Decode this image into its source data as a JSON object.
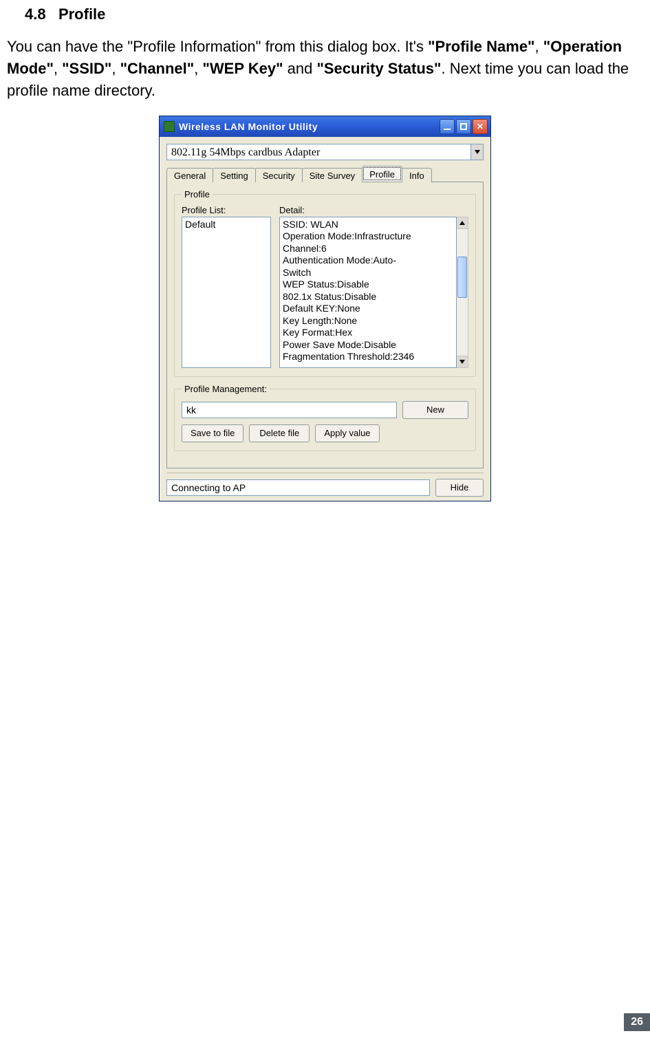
{
  "heading": {
    "number": "4.8",
    "title": "Profile"
  },
  "paragraph": {
    "p1a": "You can have the \"Profile Information\" from this dialog box. It's ",
    "b1": "\"Profile Name\"",
    "c1": ", ",
    "b2": "\"Operation Mode\"",
    "c2": ", ",
    "b3": "\"SSID\"",
    "c3": ", ",
    "b4": "\"Channel\"",
    "c4": ", ",
    "b5": "\"WEP Key\"",
    "c5": " and ",
    "b6": "\"Security Status\"",
    "p1b": ". Next time you can load the profile name directory."
  },
  "window": {
    "title": "Wireless LAN Monitor Utility",
    "adapter": "802.11g 54Mbps cardbus Adapter",
    "tabs": {
      "general": "General",
      "setting": "Setting",
      "security": "Security",
      "site_survey": "Site Survey",
      "profile": "Profile",
      "info": "Info"
    },
    "profile_group_legend": "Profile",
    "labels": {
      "profile_list": "Profile List:",
      "detail": "Detail:"
    },
    "profile_list": {
      "item0": "Default"
    },
    "detail_lines": {
      "l0": "SSID: WLAN",
      "l1": "Operation Mode:Infrastructure",
      "l2": "Channel:6",
      "l3": "Authentication Mode:Auto-",
      "l4": "Switch",
      "l5": "WEP Status:Disable",
      "l6": "802.1x Status:Disable",
      "l7": "Default KEY:None",
      "l8": "Key Length:None",
      "l9": "Key Format:Hex",
      "l10": "Power Save Mode:Disable",
      "l11": "Fragmentation Threshold:2346"
    },
    "mgmt_legend": "Profile Management:",
    "mgmt": {
      "name_value": "kk",
      "new_btn": "New",
      "save_btn": "Save to file",
      "delete_btn": "Delete file",
      "apply_btn": "Apply value"
    },
    "status": "Connecting to AP",
    "hide_btn": "Hide"
  },
  "page_number": "26"
}
